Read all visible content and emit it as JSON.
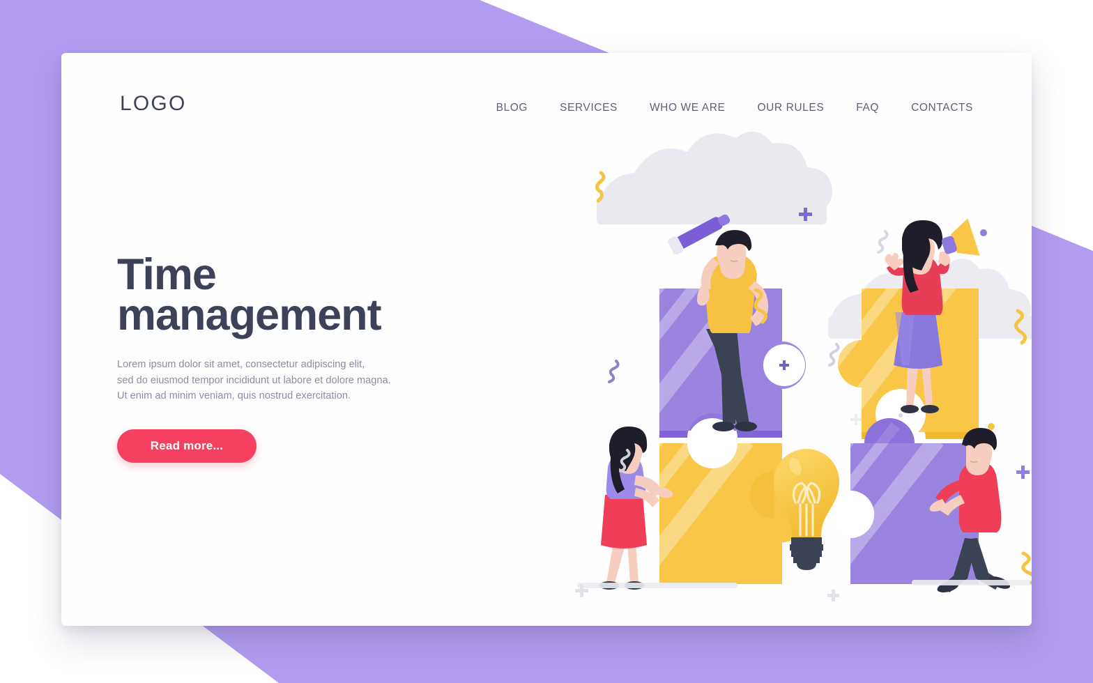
{
  "brand": {
    "logo": "LOGO"
  },
  "nav": {
    "items": [
      {
        "label": "BLOG"
      },
      {
        "label": "SERVICES"
      },
      {
        "label": "WHO WE ARE"
      },
      {
        "label": "OUR RULES"
      },
      {
        "label": "FAQ"
      },
      {
        "label": "CONTACTS"
      }
    ]
  },
  "hero": {
    "title_line1": "Time",
    "title_line2": "management",
    "paragraph_line1": "Lorem ipsum dolor sit amet, consectetur adipiscing elit,",
    "paragraph_line2": "sed do eiusmod tempor incididunt ut labore et dolore magna.",
    "paragraph_line3": "Ut enim ad minim veniam, quis nostrud exercitation.",
    "cta_label": "Read more..."
  },
  "colors": {
    "background_purple": "#b19cf0",
    "card_white": "#fefefe",
    "heading_navy": "#3e4259",
    "body_gray": "#8b8ea3",
    "nav_gray": "#5d6075",
    "cta_red": "#f64060",
    "puzzle_purple": "#9b84e0",
    "puzzle_purple_dark": "#7c5fd6",
    "puzzle_yellow": "#f9c647",
    "puzzle_yellow_dark": "#f0b427",
    "cloud_gray": "#e8e8ee",
    "skin": "#f7cdc0",
    "shirt_yellow": "#f7c242",
    "shirt_red": "#ef3e56",
    "pants_navy": "#3b4254",
    "hair_black": "#201d2b",
    "squiggle_yellow": "#f6c445",
    "squiggle_purple": "#8f83c7"
  },
  "illustration": {
    "name": "teamwork-puzzle-illustration",
    "elements": [
      {
        "name": "man-with-telescope",
        "on": "purple-puzzle-top-left"
      },
      {
        "name": "woman-with-megaphone",
        "on": "yellow-puzzle-top-right"
      },
      {
        "name": "woman-pushing-puzzle",
        "on": "yellow-puzzle-bottom-left"
      },
      {
        "name": "man-pushing-puzzle",
        "on": "purple-puzzle-bottom-right"
      },
      {
        "name": "lightbulb-idea",
        "position": "center"
      },
      {
        "name": "clouds",
        "count": 2
      },
      {
        "name": "decorative-squiggles",
        "count": 6
      },
      {
        "name": "decorative-plus-marks",
        "count": 5
      },
      {
        "name": "decorative-dots",
        "count": 2
      }
    ]
  }
}
